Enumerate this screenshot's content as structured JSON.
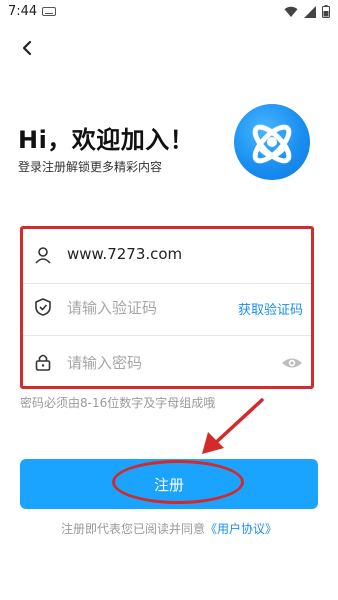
{
  "status_bar": {
    "time": "7:44"
  },
  "header": {
    "title": "Hi，欢迎加入！",
    "subtitle": "登录注册解锁更多精彩内容"
  },
  "form": {
    "username": {
      "value": "www.7273.com"
    },
    "code": {
      "placeholder": "请输入验证码",
      "get_code_label": "获取验证码"
    },
    "password": {
      "placeholder": "请输入密码"
    },
    "hint": "密码必须由8-16位数字及字母组成哦"
  },
  "register_button": {
    "label": "注册"
  },
  "agreement": {
    "text": "注册即代表您已阅读并同意",
    "link": "《用户协议》"
  },
  "colors": {
    "accent": "#1aa3ff",
    "link": "#1a8ff1",
    "annotation": "#d32a2a"
  },
  "icons": {
    "back": "chevron-left-icon",
    "user": "user-icon",
    "shield": "shield-icon",
    "lock": "lock-icon",
    "eye": "eye-icon",
    "logo": "app-logo"
  }
}
